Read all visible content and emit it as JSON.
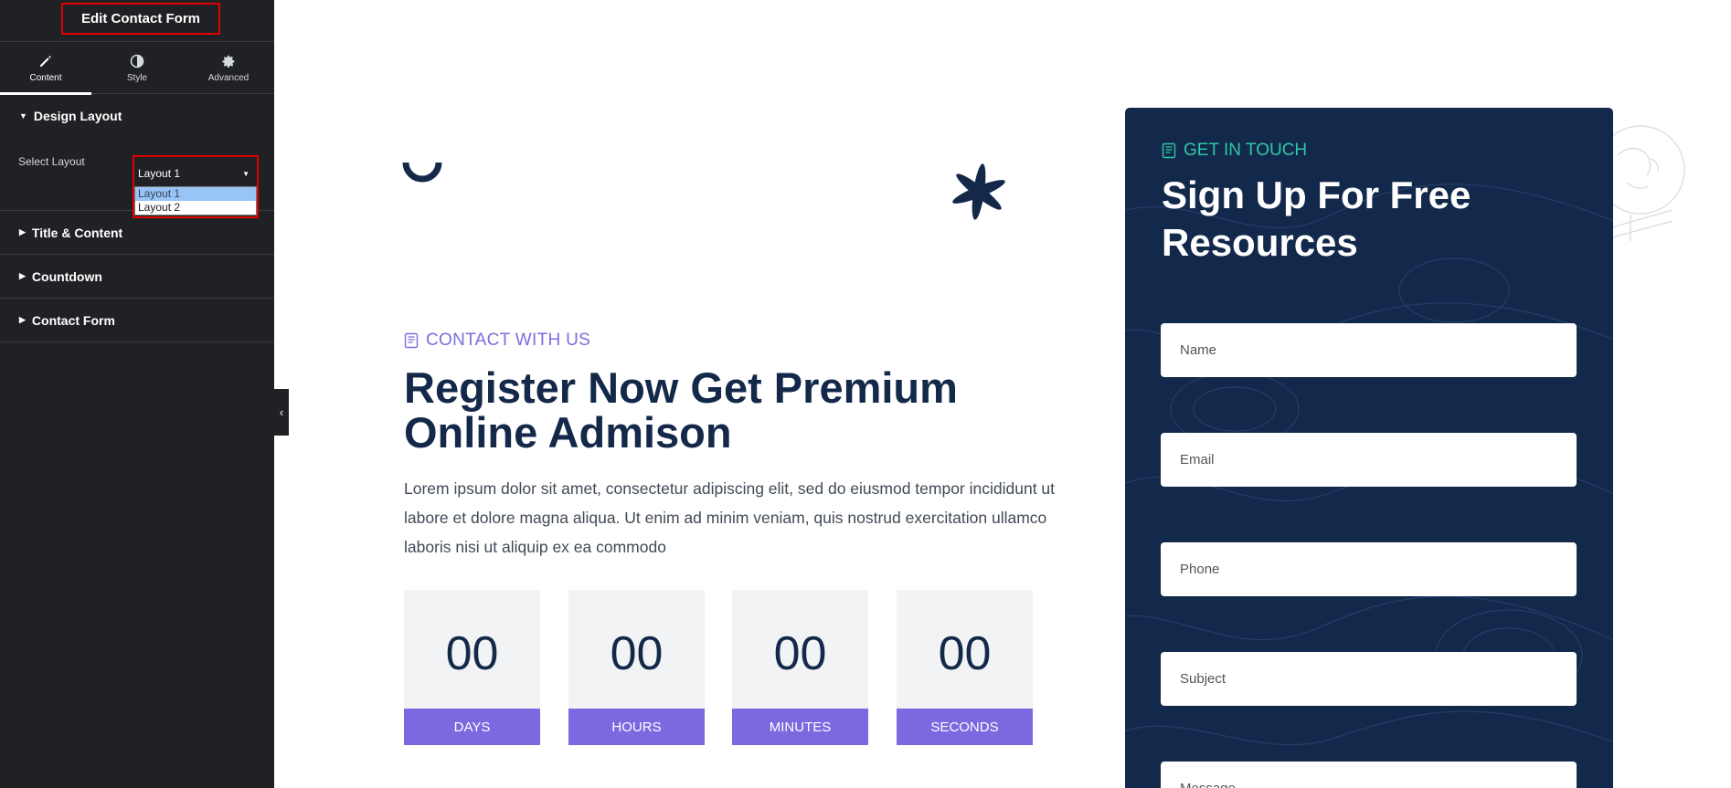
{
  "sidebar": {
    "title": "Edit Contact Form",
    "tabs": [
      {
        "label": "Content",
        "icon": "pencil-icon"
      },
      {
        "label": "Style",
        "icon": "half-circle-icon"
      },
      {
        "label": "Advanced",
        "icon": "gear-icon"
      }
    ],
    "sections": {
      "design_layout": "Design Layout",
      "title_content": "Title & Content",
      "countdown": "Countdown",
      "contact_form": "Contact Form"
    },
    "select_layout": {
      "label": "Select Layout",
      "value": "Layout 1",
      "options": [
        "Layout 1",
        "Layout 2"
      ]
    }
  },
  "main": {
    "eyebrow": "CONTACT WITH US",
    "headline": "Register Now Get Premium Online Admison",
    "description": "Lorem ipsum dolor sit amet, consectetur adipiscing elit, sed do eiusmod tempor incididunt ut labore et dolore magna aliqua. Ut enim ad minim veniam, quis nostrud exercitation ullamco laboris nisi ut aliquip ex ea commodo",
    "countdown": [
      {
        "value": "00",
        "label": "DAYS"
      },
      {
        "value": "00",
        "label": "HOURS"
      },
      {
        "value": "00",
        "label": "MINUTES"
      },
      {
        "value": "00",
        "label": "SECONDS"
      }
    ]
  },
  "form": {
    "eyebrow": "GET IN TOUCH",
    "title": "Sign Up For Free Resources",
    "fields": {
      "name": "Name",
      "email": "Email",
      "phone": "Phone",
      "subject": "Subject",
      "message": "Message"
    }
  },
  "colors": {
    "sidebar_bg": "#202124",
    "navy": "#14294a",
    "purple": "#7b69e0",
    "teal": "#2ec7a6",
    "highlight_red": "#e00000"
  }
}
